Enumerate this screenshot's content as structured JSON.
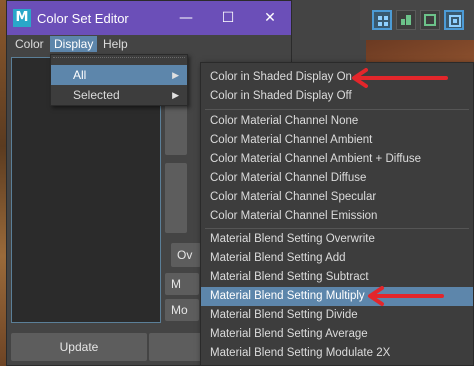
{
  "window": {
    "title": "Color Set Editor",
    "logo_letter": "M",
    "minimize_glyph": "—",
    "maximize_glyph": "☐",
    "close_glyph": "✕"
  },
  "menubar": [
    "Color",
    "Display",
    "Help"
  ],
  "display_menu": [
    {
      "label": "All",
      "has_submenu": true,
      "highlighted": true
    },
    {
      "label": "Selected",
      "has_submenu": true,
      "highlighted": false
    }
  ],
  "submenu_groups": [
    {
      "items": [
        {
          "label": "Color in Shaded Display On",
          "highlighted": false,
          "annotated": true
        },
        {
          "label": "Color in Shaded Display Off",
          "highlighted": false,
          "annotated": false
        }
      ]
    },
    {
      "items": [
        {
          "label": "Color Material Channel None",
          "highlighted": false,
          "annotated": false
        },
        {
          "label": "Color Material Channel Ambient",
          "highlighted": false,
          "annotated": false
        },
        {
          "label": "Color Material Channel Ambient + Diffuse",
          "highlighted": false,
          "annotated": false
        },
        {
          "label": "Color Material Channel Diffuse",
          "highlighted": false,
          "annotated": false
        },
        {
          "label": "Color Material Channel Specular",
          "highlighted": false,
          "annotated": false
        },
        {
          "label": "Color Material Channel Emission",
          "highlighted": false,
          "annotated": false
        }
      ]
    },
    {
      "items": [
        {
          "label": "Material Blend Setting Overwrite",
          "highlighted": false,
          "annotated": false
        },
        {
          "label": "Material Blend Setting Add",
          "highlighted": false,
          "annotated": false
        },
        {
          "label": "Material Blend Setting Subtract",
          "highlighted": false,
          "annotated": false
        },
        {
          "label": "Material Blend Setting Multiply",
          "highlighted": true,
          "annotated": true
        },
        {
          "label": "Material Blend Setting Divide",
          "highlighted": false,
          "annotated": false
        },
        {
          "label": "Material Blend Setting Average",
          "highlighted": false,
          "annotated": false
        },
        {
          "label": "Material Blend Setting Modulate 2X",
          "highlighted": false,
          "annotated": false
        }
      ]
    }
  ],
  "side_buttons": [
    "Ov",
    "M",
    "Mo"
  ],
  "bottom_buttons": [
    "Update",
    ""
  ],
  "colors": {
    "titlebar": "#6b4fb8",
    "highlight": "#5d86ab",
    "annotation": "#e3262b",
    "logo": "#2aa7c9"
  },
  "icons": [
    "maya-logo-icon",
    "minimize-icon",
    "maximize-icon",
    "close-icon",
    "submenu-arrow-icon",
    "red-annotation-arrow-icon",
    "toolbar-layout-icon"
  ]
}
